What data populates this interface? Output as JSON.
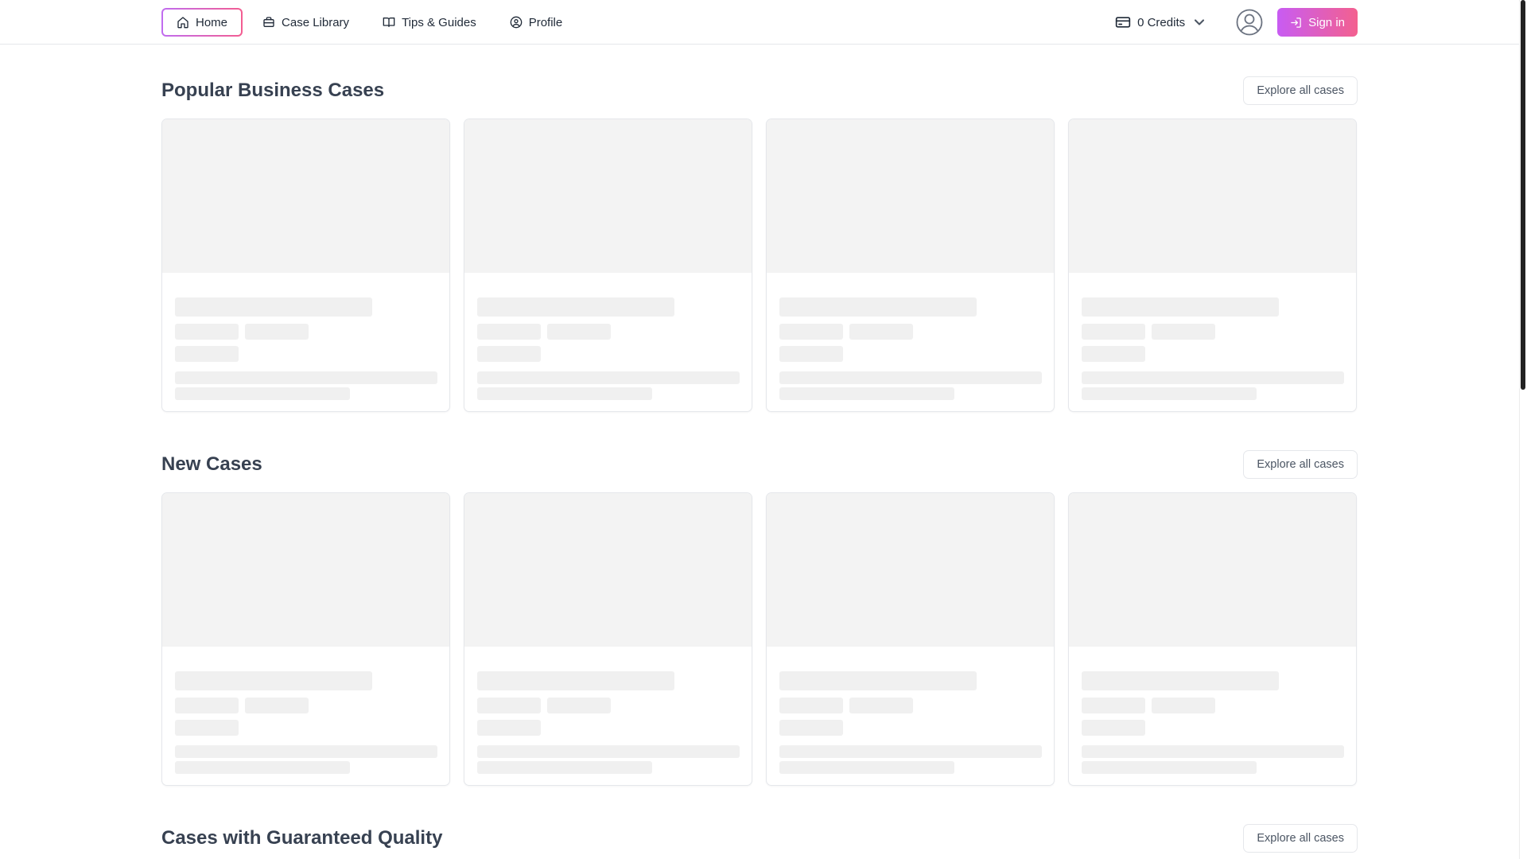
{
  "nav": {
    "items": [
      {
        "label": "Home",
        "icon": "home-icon",
        "active": true
      },
      {
        "label": "Case Library",
        "icon": "briefcase-icon"
      },
      {
        "label": "Tips & Guides",
        "icon": "book-icon"
      },
      {
        "label": "Profile",
        "icon": "user-circle-icon"
      }
    ],
    "credits_label": "0 Credits",
    "signin_label": "Sign in"
  },
  "colors": {
    "accent_start": "#c85cf3",
    "accent_end": "#f3608f",
    "skeleton": "#f0f0f0"
  },
  "sections": [
    {
      "title": "Popular Business Cases",
      "explore_label": "Explore all cases"
    },
    {
      "title": "New Cases",
      "explore_label": "Explore all cases"
    },
    {
      "title": "Cases with Guaranteed Quality",
      "explore_label": "Explore all cases"
    }
  ]
}
